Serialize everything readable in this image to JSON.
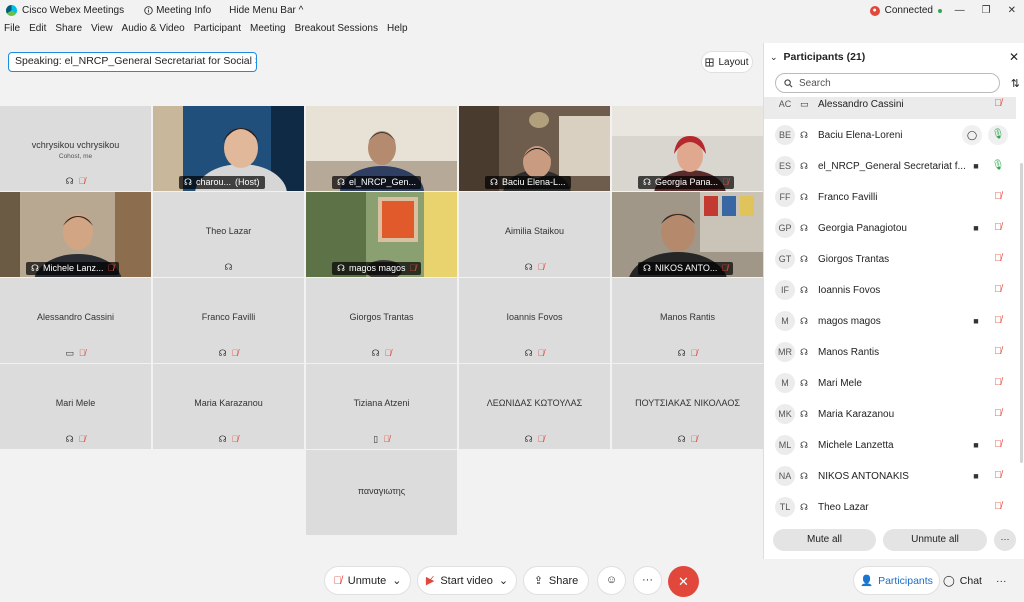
{
  "titlebar": {
    "app_title": "Cisco Webex Meetings",
    "meeting_info": "Meeting Info",
    "hide_menu": "Hide Menu Bar",
    "connection_status": "Connected"
  },
  "menu": [
    "File",
    "Edit",
    "Share",
    "View",
    "Audio & Video",
    "Participant",
    "Meeting",
    "Breakout Sessions",
    "Help"
  ],
  "speaking": {
    "label": "Speaking:",
    "name": "el_NRCP_General Secretariat for Social Soli..."
  },
  "layout_button": "Layout",
  "tiles": {
    "t00": {
      "name": "vchrysikou vchrysikou",
      "sub": "Cohost, me"
    },
    "t01": {
      "name": "charou...",
      "host": "(Host)"
    },
    "t02": {
      "name": "el_NRCP_Gen..."
    },
    "t03": {
      "name": "Baciu Elena-L..."
    },
    "t04": {
      "name": "Georgia Pana..."
    },
    "t10": {
      "name": "Michele Lanz..."
    },
    "t11": {
      "name": "Theo Lazar"
    },
    "t12": {
      "name": "magos magos"
    },
    "t13": {
      "name": "Aimilia Staikou"
    },
    "t14": {
      "name": "NIKOS ANTO..."
    },
    "t20": {
      "name": "Alessandro Cassini"
    },
    "t21": {
      "name": "Franco Favilli"
    },
    "t22": {
      "name": "Giorgos Trantas"
    },
    "t23": {
      "name": "Ioannis Fovos"
    },
    "t24": {
      "name": "Manos Rantis"
    },
    "t30": {
      "name": "Mari Mele"
    },
    "t31": {
      "name": "Maria Karazanou"
    },
    "t32": {
      "name": "Tiziana Atzeni"
    },
    "t33": {
      "name": "ΛΕΩΝΙΔΑΣ ΚΩΤΟΥΛΑΣ"
    },
    "t34": {
      "name": "ΠΟΥΤΣΙΑΚΑΣ ΝΙΚΟΛΑΟΣ"
    },
    "t42": {
      "name": "παναγιωτης"
    }
  },
  "panel": {
    "title": "Participants (21)",
    "search_placeholder": "Search",
    "rows": [
      {
        "initials": "AC",
        "name": "Alessandro Cassini"
      },
      {
        "initials": "BE",
        "name": "Baciu Elena-Loreni"
      },
      {
        "initials": "ES",
        "name": "el_NRCP_General Secretariat f..."
      },
      {
        "initials": "FF",
        "name": "Franco Favilli"
      },
      {
        "initials": "GP",
        "name": "Georgia Panagiotou"
      },
      {
        "initials": "GT",
        "name": "Giorgos Trantas"
      },
      {
        "initials": "IF",
        "name": "Ioannis Fovos"
      },
      {
        "initials": "M",
        "name": "magos magos"
      },
      {
        "initials": "MR",
        "name": "Manos Rantis"
      },
      {
        "initials": "M",
        "name": "Mari Mele"
      },
      {
        "initials": "MK",
        "name": "Maria Karazanou"
      },
      {
        "initials": "ML",
        "name": "Michele Lanzetta"
      },
      {
        "initials": "NA",
        "name": "NIKOS ANTONAKIS"
      },
      {
        "initials": "TL",
        "name": "Theo Lazar"
      }
    ],
    "mute_all": "Mute all",
    "unmute_all": "Unmute all"
  },
  "bottom": {
    "unmute": "Unmute",
    "start_video": "Start video",
    "share": "Share",
    "participants": "Participants",
    "chat": "Chat"
  },
  "colors": {
    "accent": "#1b8de0",
    "mute_red": "#e2473b",
    "end_red": "#e2473b",
    "speaker_outline": "#20b6e8"
  },
  "icons": [
    "webex-logo-icon",
    "info-icon",
    "chevron-up-icon",
    "record-icon",
    "minimize-icon",
    "restore-icon",
    "close-icon",
    "layout-grid-icon",
    "headset-icon",
    "mic-muted-icon",
    "video-camera-icon",
    "phone-icon",
    "search-icon",
    "sort-icon",
    "chat-icon",
    "emoji-icon",
    "more-icon",
    "end-call-icon"
  ]
}
